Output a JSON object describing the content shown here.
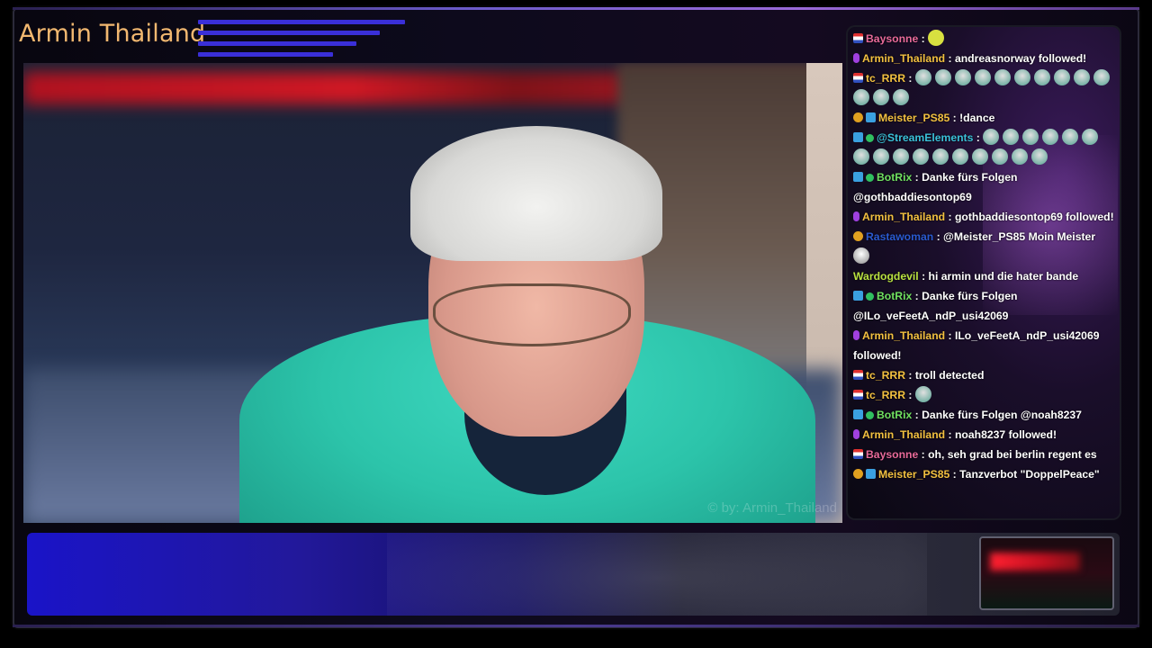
{
  "overlay": {
    "title": "Armin Thailand",
    "accent_color": "#f2b870",
    "bar_color": "#3a2fd8"
  },
  "camera": {
    "watermark": "© by: Armin_Thailand"
  },
  "chat": {
    "messages": [
      {
        "badges": [
          "flag"
        ],
        "user": "Baysonne",
        "user_color": "#e86a9a",
        "text": "",
        "emotes": [
          "frog"
        ]
      },
      {
        "badges": [
          "mic"
        ],
        "user": "Armin_Thailand",
        "user_color": "#f2c040",
        "text": "andreasnorway followed!"
      },
      {
        "badges": [
          "flag"
        ],
        "user": "tc_RRR",
        "user_color": "#f2c040",
        "text": "",
        "emotes": [
          "ghost",
          "ghost",
          "ghost",
          "ghost",
          "ghost",
          "ghost",
          "ghost",
          "ghost",
          "ghost",
          "ghost",
          "ghost",
          "ghost",
          "ghost"
        ]
      },
      {
        "badges": [
          "gold",
          "mod"
        ],
        "user": "Meister_PS85",
        "user_color": "#f2c040",
        "text": "!dance"
      },
      {
        "badges": [
          "mod",
          "check"
        ],
        "user": "@StreamElements",
        "user_color": "#3ac0d8",
        "text": "",
        "emotes": [
          "dance",
          "dance",
          "dance",
          "dance",
          "dance",
          "dance",
          "dance",
          "dance",
          "dance",
          "dance",
          "dance",
          "dance",
          "dance",
          "dance",
          "dance",
          "dance"
        ]
      },
      {
        "badges": [
          "mod",
          "check"
        ],
        "user": "BotRix",
        "user_color": "#70e060",
        "text": "Danke fürs Folgen @gothbaddiesontop69"
      },
      {
        "badges": [
          "mic"
        ],
        "user": "Armin_Thailand",
        "user_color": "#f2c040",
        "text": "gothbaddiesontop69 followed!"
      },
      {
        "badges": [
          "gold"
        ],
        "user": "Rastawoman",
        "user_color": "#2a5ad0",
        "text": "@Meister_PS85 Moin Meister",
        "emotes": [
          "ghost2"
        ]
      },
      {
        "badges": [],
        "user": "Wardogdevil",
        "user_color": "#b8e040",
        "text": "hi armin und die hater bande"
      },
      {
        "badges": [
          "mod",
          "check"
        ],
        "user": "BotRix",
        "user_color": "#70e060",
        "text": "Danke fürs Folgen @ILo_veFeetA_ndP_usi42069"
      },
      {
        "badges": [
          "mic"
        ],
        "user": "Armin_Thailand",
        "user_color": "#f2c040",
        "text": "ILo_veFeetA_ndP_usi42069 followed!"
      },
      {
        "badges": [
          "flag"
        ],
        "user": "tc_RRR",
        "user_color": "#f2c040",
        "text": "troll detected"
      },
      {
        "badges": [
          "flag"
        ],
        "user": "tc_RRR",
        "user_color": "#f2c040",
        "text": "",
        "emotes": [
          "ghost"
        ]
      },
      {
        "badges": [
          "mod",
          "check"
        ],
        "user": "BotRix",
        "user_color": "#70e060",
        "text": "Danke fürs Folgen @noah8237"
      },
      {
        "badges": [
          "mic"
        ],
        "user": "Armin_Thailand",
        "user_color": "#f2c040",
        "text": "noah8237 followed!"
      },
      {
        "badges": [
          "flag"
        ],
        "user": "Baysonne",
        "user_color": "#e86a9a",
        "text": "oh, seh grad bei berlin regent es"
      },
      {
        "badges": [
          "gold",
          "mod"
        ],
        "user": "Meister_PS85",
        "user_color": "#f2c040",
        "text": "Tanzverbot \"DoppelPeace\""
      }
    ]
  }
}
